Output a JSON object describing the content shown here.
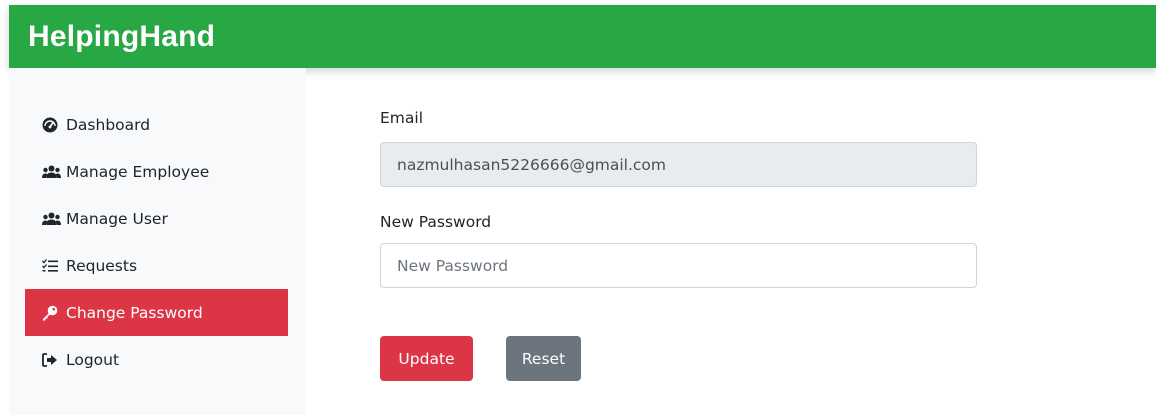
{
  "brand": "HelpingHand",
  "sidebar": {
    "items": [
      {
        "label": "Dashboard",
        "icon": "tachometer-icon",
        "active": false
      },
      {
        "label": "Manage Employee",
        "icon": "users-icon",
        "active": false
      },
      {
        "label": "Manage User",
        "icon": "users-icon",
        "active": false
      },
      {
        "label": "Requests",
        "icon": "tasks-list-icon",
        "active": false
      },
      {
        "label": "Change Password",
        "icon": "key-icon",
        "active": true
      },
      {
        "label": "Logout",
        "icon": "sign-out-icon",
        "active": false
      }
    ]
  },
  "form": {
    "email_label": "Email",
    "email_value": "nazmulhasan5226666@gmail.com",
    "password_label": "New Password",
    "password_placeholder": "New Password",
    "password_value": "",
    "update_label": "Update",
    "reset_label": "Reset"
  },
  "colors": {
    "navbar": "#28a745",
    "active": "#dc3545",
    "reset": "#6c757d",
    "sidebar_bg": "#f8f9fa",
    "readonly_bg": "#e9ecef"
  }
}
